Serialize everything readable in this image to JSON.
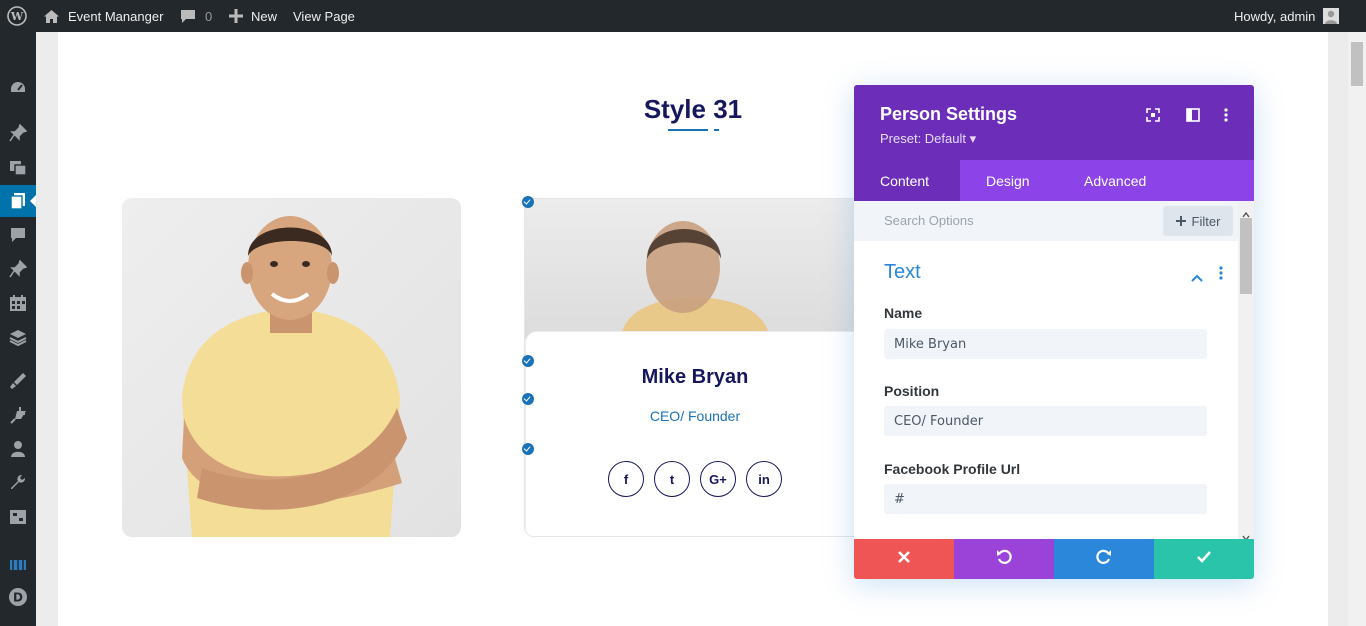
{
  "admin_bar": {
    "site_name": "Event Mananger",
    "comments_count": "0",
    "new_label": "New",
    "view_page_label": "View Page",
    "greeting": "Howdy, admin"
  },
  "admin_menu": {
    "items": [
      "dashboard-icon",
      "pin-icon",
      "media-icon",
      "pages-icon",
      "comments-icon",
      "pin-icon",
      "calendar-icon",
      "layers-icon",
      "appearance-icon",
      "plugins-icon",
      "users-icon",
      "tools-icon",
      "settings-icon",
      "builder-icon",
      "divi-icon"
    ]
  },
  "page": {
    "section_title": "Style 31",
    "person": {
      "name": "Mike Bryan",
      "position": "CEO/ Founder",
      "social": [
        "f",
        "t",
        "G+",
        "in"
      ]
    }
  },
  "modal": {
    "title": "Person Settings",
    "preset": "Preset: Default ▾",
    "tabs": [
      "Content",
      "Design",
      "Advanced"
    ],
    "active_tab": "Content",
    "search_placeholder": "Search Options",
    "filter_label": "Filter",
    "section_title": "Text",
    "fields": [
      {
        "label": "Name",
        "value": "Mike Bryan"
      },
      {
        "label": "Position",
        "value": "CEO/ Founder"
      },
      {
        "label": "Facebook Profile Url",
        "value": "#"
      }
    ]
  },
  "colors": {
    "admin_bar": "#23282d",
    "accent_blue": "#0073aa",
    "modal_header": "#6c2eb9",
    "modal_tabs": "#8c44e8",
    "title_navy": "#17175e",
    "cancel_red": "#ef5555",
    "undo_purple": "#9b42d9",
    "redo_blue": "#2b87da",
    "save_green": "#29c4a9"
  }
}
